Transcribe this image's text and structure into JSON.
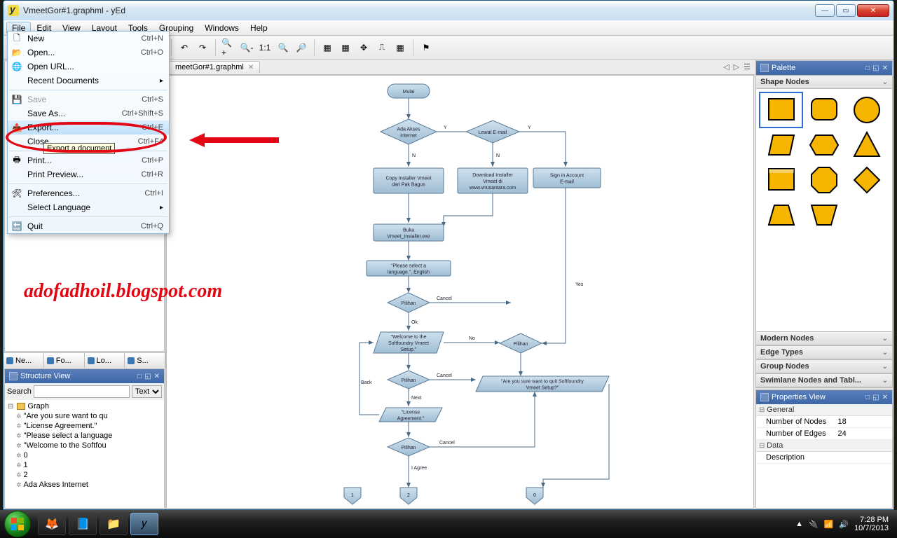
{
  "window": {
    "title": "VmeetGor#1.graphml - yEd"
  },
  "menubar": [
    "File",
    "Edit",
    "View",
    "Layout",
    "Tools",
    "Grouping",
    "Windows",
    "Help"
  ],
  "dropdown": {
    "items": [
      {
        "icon": "🗋",
        "label": "New",
        "shortcut": "Ctrl+N"
      },
      {
        "icon": "📂",
        "label": "Open...",
        "shortcut": "Ctrl+O"
      },
      {
        "icon": "🌐",
        "label": "Open URL..."
      },
      {
        "label": "Recent Documents",
        "submenu": true
      },
      {
        "sep": true
      },
      {
        "icon": "💾",
        "label": "Save",
        "shortcut": "Ctrl+S",
        "disabled": true
      },
      {
        "label": "Save As...",
        "shortcut": "Ctrl+Shift+S"
      },
      {
        "icon": "📤",
        "label": "Export...",
        "shortcut": "Ctrl+E",
        "hl": true
      },
      {
        "label": "Close",
        "shortcut": "Ctrl+F4"
      },
      {
        "sep": true
      },
      {
        "icon": "🖶",
        "label": "Print...",
        "shortcut": "Ctrl+P"
      },
      {
        "label": "Print Preview...",
        "shortcut": "Ctrl+R"
      },
      {
        "sep": true
      },
      {
        "icon": "🛠",
        "label": "Preferences...",
        "shortcut": "Ctrl+I"
      },
      {
        "label": "Select Language",
        "submenu": true
      },
      {
        "sep": true
      },
      {
        "icon": "🔚",
        "label": "Quit",
        "shortcut": "Ctrl+Q"
      }
    ],
    "tooltip": "Export a document"
  },
  "doctab": {
    "label": "meetGor#1.graphml"
  },
  "left_tabs": [
    "Ne...",
    "Fo...",
    "Lo...",
    "S..."
  ],
  "structure": {
    "title": "Structure View",
    "search_label": "Search",
    "mode": "Text",
    "root": "Graph",
    "nodes": [
      "\"Are you sure want to qu",
      "\"License Agreement.\"",
      "\"Please select a language",
      "\"Welcome to the  Softfou",
      "0",
      "1",
      "2",
      "Ada Akses Internet"
    ]
  },
  "palette": {
    "title": "Palette",
    "sections": [
      "Shape Nodes",
      "Modern Nodes",
      "Edge Types",
      "Group Nodes",
      "Swimlane Nodes and Tabl..."
    ]
  },
  "props": {
    "title": "Properties View",
    "groups": [
      {
        "name": "General",
        "rows": [
          {
            "k": "Number of Nodes",
            "v": "18"
          },
          {
            "k": "Number of Edges",
            "v": "24"
          }
        ]
      },
      {
        "name": "Data",
        "rows": [
          {
            "k": "Description",
            "v": ""
          }
        ]
      }
    ]
  },
  "flow": {
    "start": "Mulai",
    "d1": "Ada Akses Internet",
    "d1y": "Y",
    "d1n": "N",
    "d2": "Lewat E-mail",
    "d2y": "Y",
    "d2n": "N",
    "p1": "Copy Installer Vmeet dari Pak Bagus",
    "p2": "Download Installer Vmeet di www.vnusantara.com",
    "p3": "Sign in Account E-mail",
    "p4": "Buka Vmeet_Installer.exe",
    "p5": "\"Please select a language.\", English",
    "d3": "Pilihan",
    "d3ok": "Ok",
    "d3cancel": "Cancel",
    "p6": "\"Welcome to the Softfoundry Vmeet Setup.\"",
    "d4": "Pilihan",
    "d4no": "No",
    "d4yes": "Yes",
    "p7": "\"Are you sure want to quit Softfoundry  Vmeet Setup?\"",
    "d5": "Pilihan",
    "d5next": "Next",
    "d5cancel": "Cancel",
    "p8": "\"License Agreement.\"",
    "back": "Back",
    "d6": "Pilihan",
    "d6agree": "I Agree",
    "d6cancel": "Cancel",
    "off": [
      "1",
      "2",
      "0"
    ]
  },
  "annotation": {
    "text": "adofadhoil.blogspot.com"
  },
  "taskbar": {
    "time": "7:28 PM",
    "date": "10/7/2013"
  }
}
